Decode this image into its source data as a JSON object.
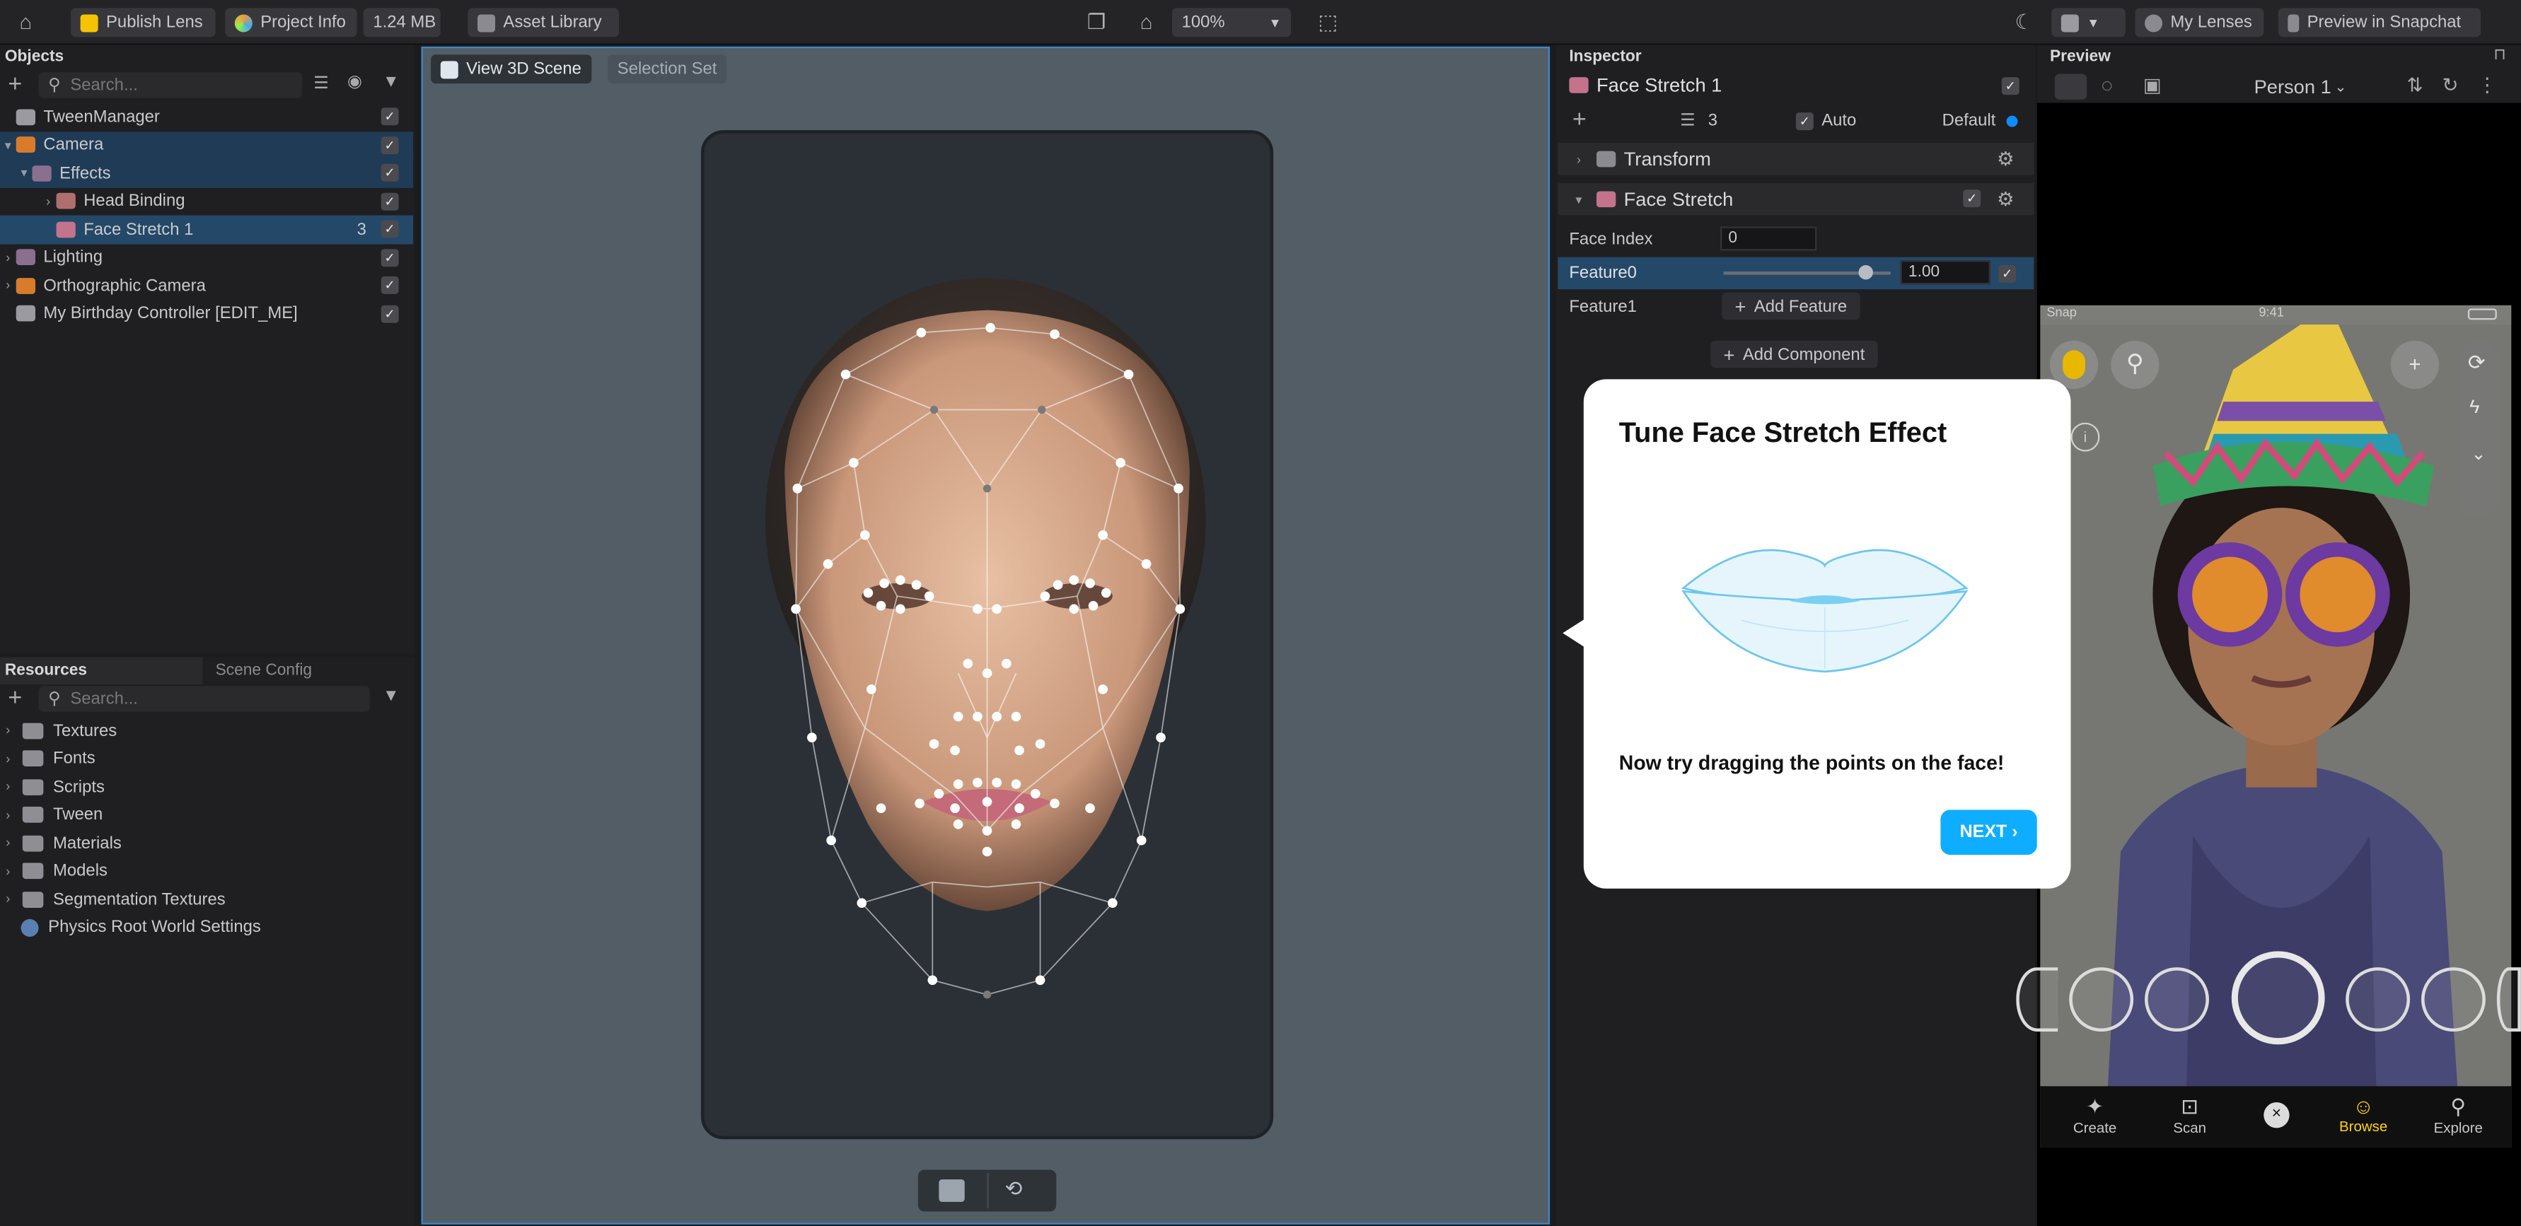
{
  "topbar": {
    "publish_label": "Publish Lens",
    "project_info_label": "Project Info",
    "size_label": "1.24 MB",
    "asset_library_label": "Asset Library",
    "zoom_value": "100%",
    "my_lenses_label": "My Lenses",
    "preview_snapchat_label": "Preview in Snapchat"
  },
  "objects": {
    "title": "Objects",
    "search_placeholder": "Search...",
    "items": [
      {
        "label": "TweenManager"
      },
      {
        "label": "Camera"
      },
      {
        "label": "Effects"
      },
      {
        "label": "Head Binding"
      },
      {
        "label": "Face Stretch 1",
        "badge": "3"
      },
      {
        "label": "Lighting"
      },
      {
        "label": "Orthographic Camera"
      },
      {
        "label": "My Birthday Controller [EDIT_ME]"
      }
    ]
  },
  "resources": {
    "tab_resources": "Resources",
    "tab_scene_config": "Scene Config",
    "search_placeholder": "Search...",
    "items": [
      {
        "label": "Textures"
      },
      {
        "label": "Fonts"
      },
      {
        "label": "Scripts"
      },
      {
        "label": "Tween"
      },
      {
        "label": "Materials"
      },
      {
        "label": "Models"
      },
      {
        "label": "Segmentation Textures"
      },
      {
        "label": "Physics Root World Settings"
      }
    ]
  },
  "scene": {
    "tab_view3d": "View 3D Scene",
    "tab_selection_set": "Selection Set"
  },
  "inspector": {
    "title": "Inspector",
    "object_name": "Face Stretch 1",
    "layer_count": "3",
    "auto_label": "Auto",
    "default_label": "Default",
    "transform_label": "Transform",
    "face_stretch_label": "Face Stretch",
    "face_index_label": "Face Index",
    "face_index_value": "0",
    "feature0_label": "Feature0",
    "feature0_value": "1.00",
    "feature0_slider_fraction": 0.85,
    "feature1_label": "Feature1",
    "add_feature_label": "Add Feature",
    "add_component_label": "Add Component"
  },
  "popup": {
    "title": "Tune Face Stretch Effect",
    "body": "Now try dragging the points on the face!",
    "next_label": "NEXT ›"
  },
  "preview": {
    "title": "Preview",
    "person_label": "Person 1",
    "status_carrier": "Snap",
    "status_time": "9:41",
    "tabs": [
      {
        "label": "Create"
      },
      {
        "label": "Scan"
      },
      {
        "label": "Browse"
      },
      {
        "label": "Explore"
      }
    ]
  },
  "colors": {
    "accent": "#0fadff",
    "selection": "#244868",
    "scene_border": "#3a87c9",
    "browse_active": "#ffd400"
  }
}
